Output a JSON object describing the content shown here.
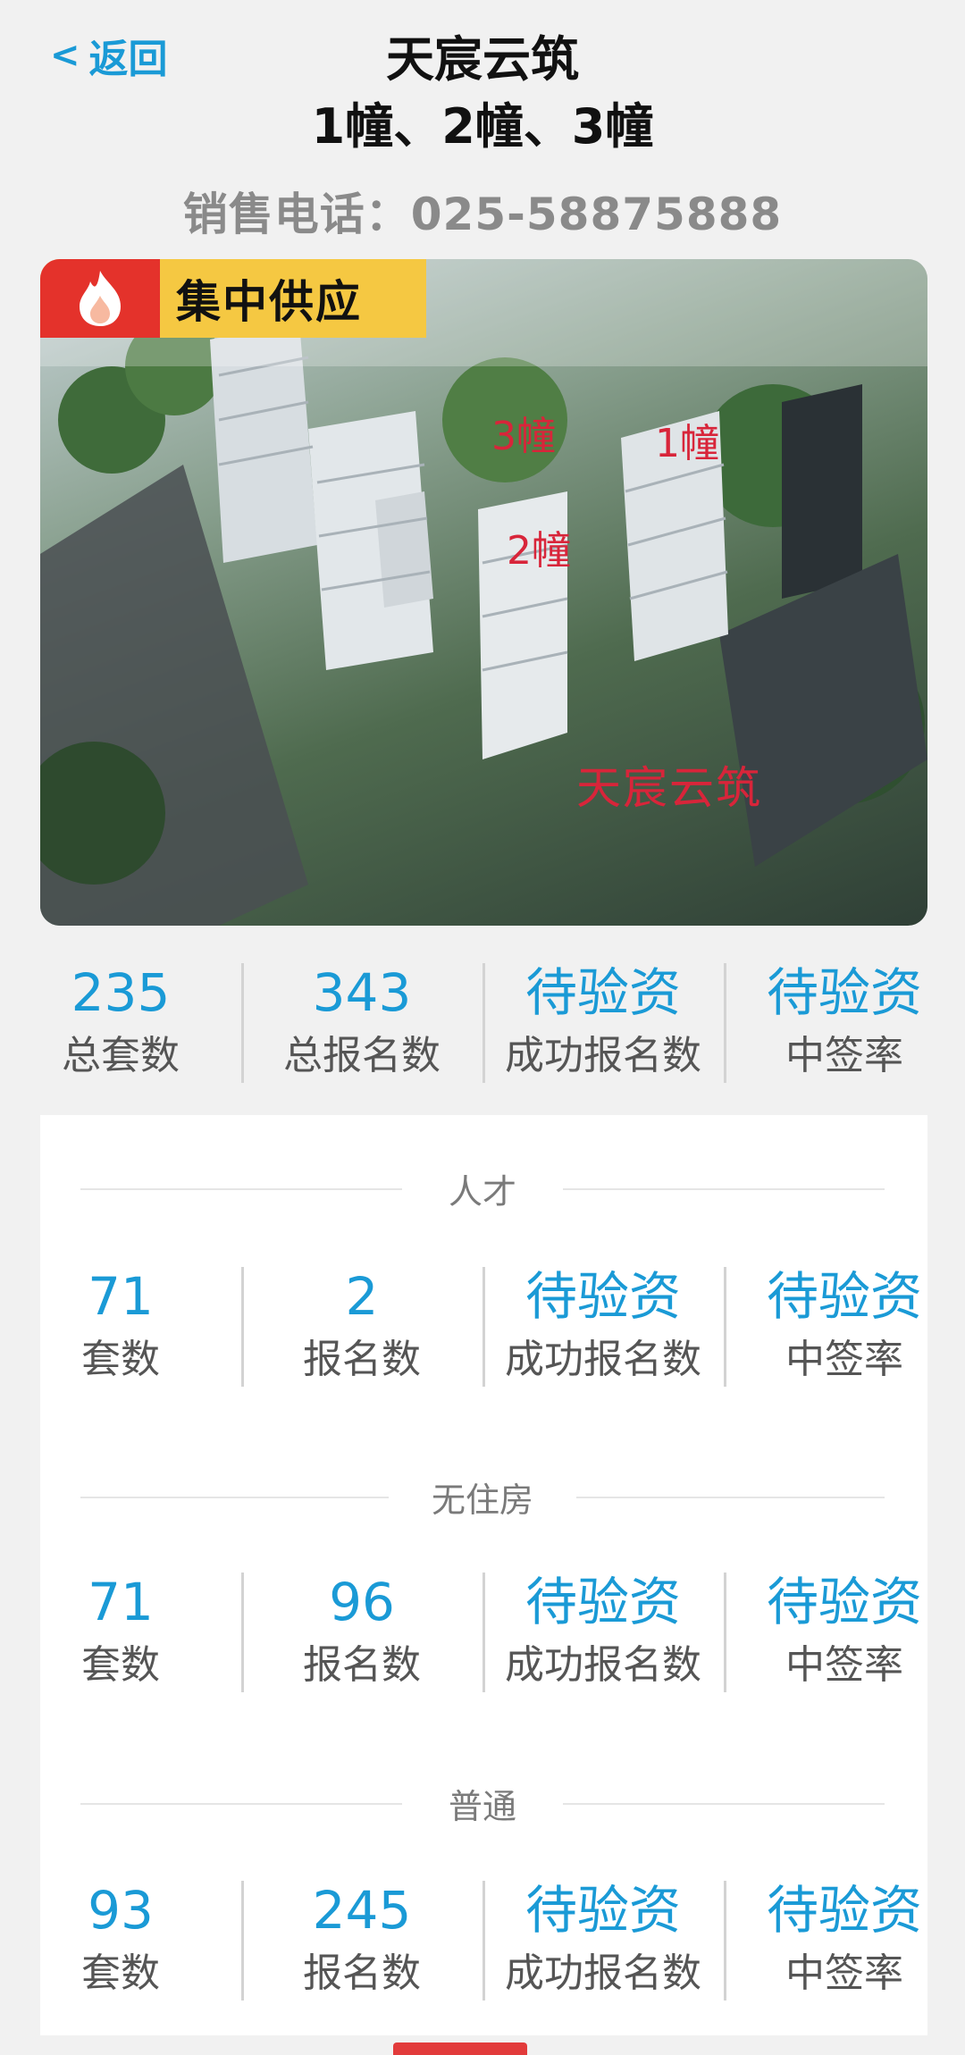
{
  "header": {
    "back_label": "返回",
    "title_line1": "天宸云筑",
    "title_line2": "1幢、2幢、3幢",
    "phone": "销售电话：025-58875888"
  },
  "hero": {
    "badge": "集中供应",
    "labels": {
      "b3": "3幢",
      "b1": "1幢",
      "b2": "2幢",
      "brand": "天宸云筑"
    }
  },
  "summary": [
    {
      "value": "235",
      "label": "总套数"
    },
    {
      "value": "343",
      "label": "总报名数"
    },
    {
      "value": "待验资",
      "label": "成功报名数"
    },
    {
      "value": "待验资",
      "label": "中签率"
    }
  ],
  "sections": [
    {
      "title": "人才",
      "stats": [
        {
          "value": "71",
          "label": "套数"
        },
        {
          "value": "2",
          "label": "报名数"
        },
        {
          "value": "待验资",
          "label": "成功报名数"
        },
        {
          "value": "待验资",
          "label": "中签率"
        }
      ]
    },
    {
      "title": "无住房",
      "stats": [
        {
          "value": "71",
          "label": "套数"
        },
        {
          "value": "96",
          "label": "报名数"
        },
        {
          "value": "待验资",
          "label": "成功报名数"
        },
        {
          "value": "待验资",
          "label": "中签率"
        }
      ]
    },
    {
      "title": "普通",
      "stats": [
        {
          "value": "93",
          "label": "套数"
        },
        {
          "value": "245",
          "label": "报名数"
        },
        {
          "value": "待验资",
          "label": "成功报名数"
        },
        {
          "value": "待验资",
          "label": "中签率"
        }
      ]
    }
  ],
  "colors": {
    "accent": "#1a9ad6",
    "badge_bg": "#f5c842",
    "badge_icon_bg": "#e4322b",
    "label_red": "#d8253a"
  }
}
